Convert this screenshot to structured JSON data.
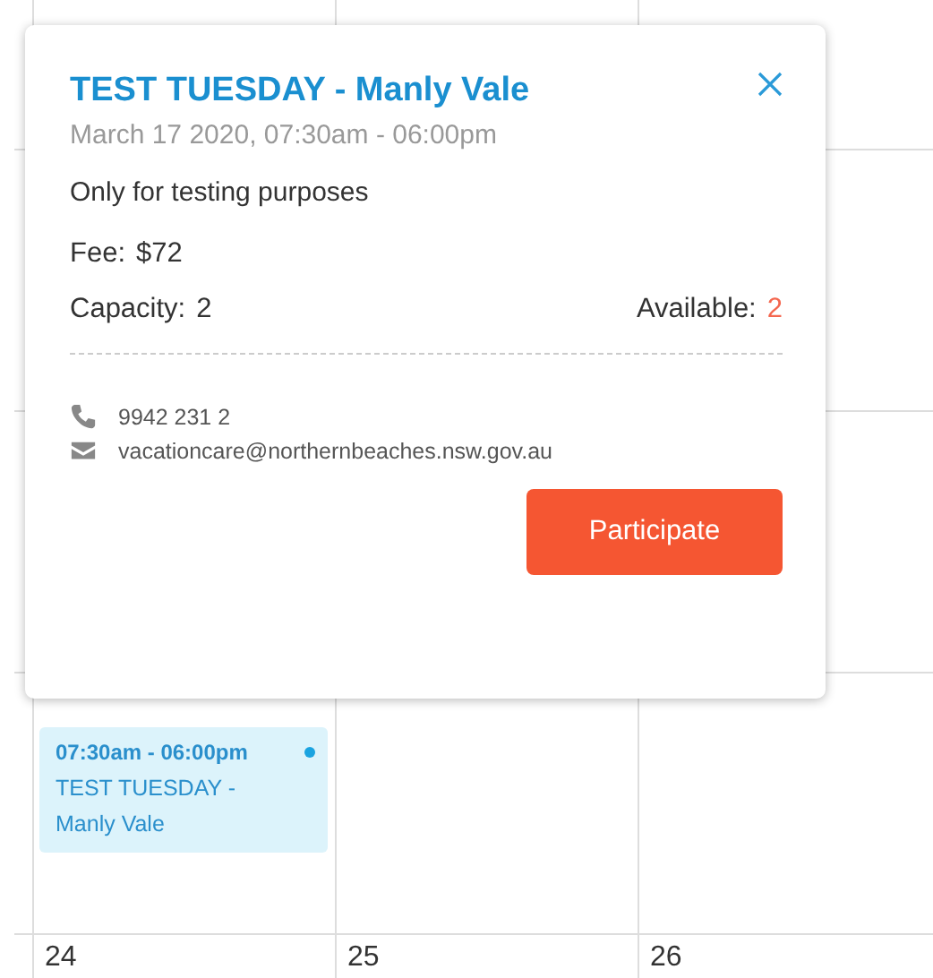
{
  "popup": {
    "title": "TEST TUESDAY - Manly Vale",
    "datetime": "March 17 2020, 07:30am - 06:00pm",
    "description": "Only for testing purposes",
    "fee_label": "Fee:",
    "fee": "$72",
    "capacity_label": "Capacity:",
    "capacity": "2",
    "available_label": "Available:",
    "available": "2",
    "phone": "9942 231 2",
    "email": "vacationcare@northernbeaches.nsw.gov.au",
    "button": "Participate"
  },
  "calendar": {
    "weeks": [
      {
        "days": [
          {
            "events": [
              {
                "time": "07:30am - 06:00pm",
                "title": "TEST TUESDAY - Manly Vale",
                "color": "#1aa3e0"
              }
            ]
          }
        ]
      },
      {
        "days": [
          {
            "number": "24"
          },
          {
            "number": "25"
          },
          {
            "number": "26"
          }
        ]
      }
    ]
  }
}
